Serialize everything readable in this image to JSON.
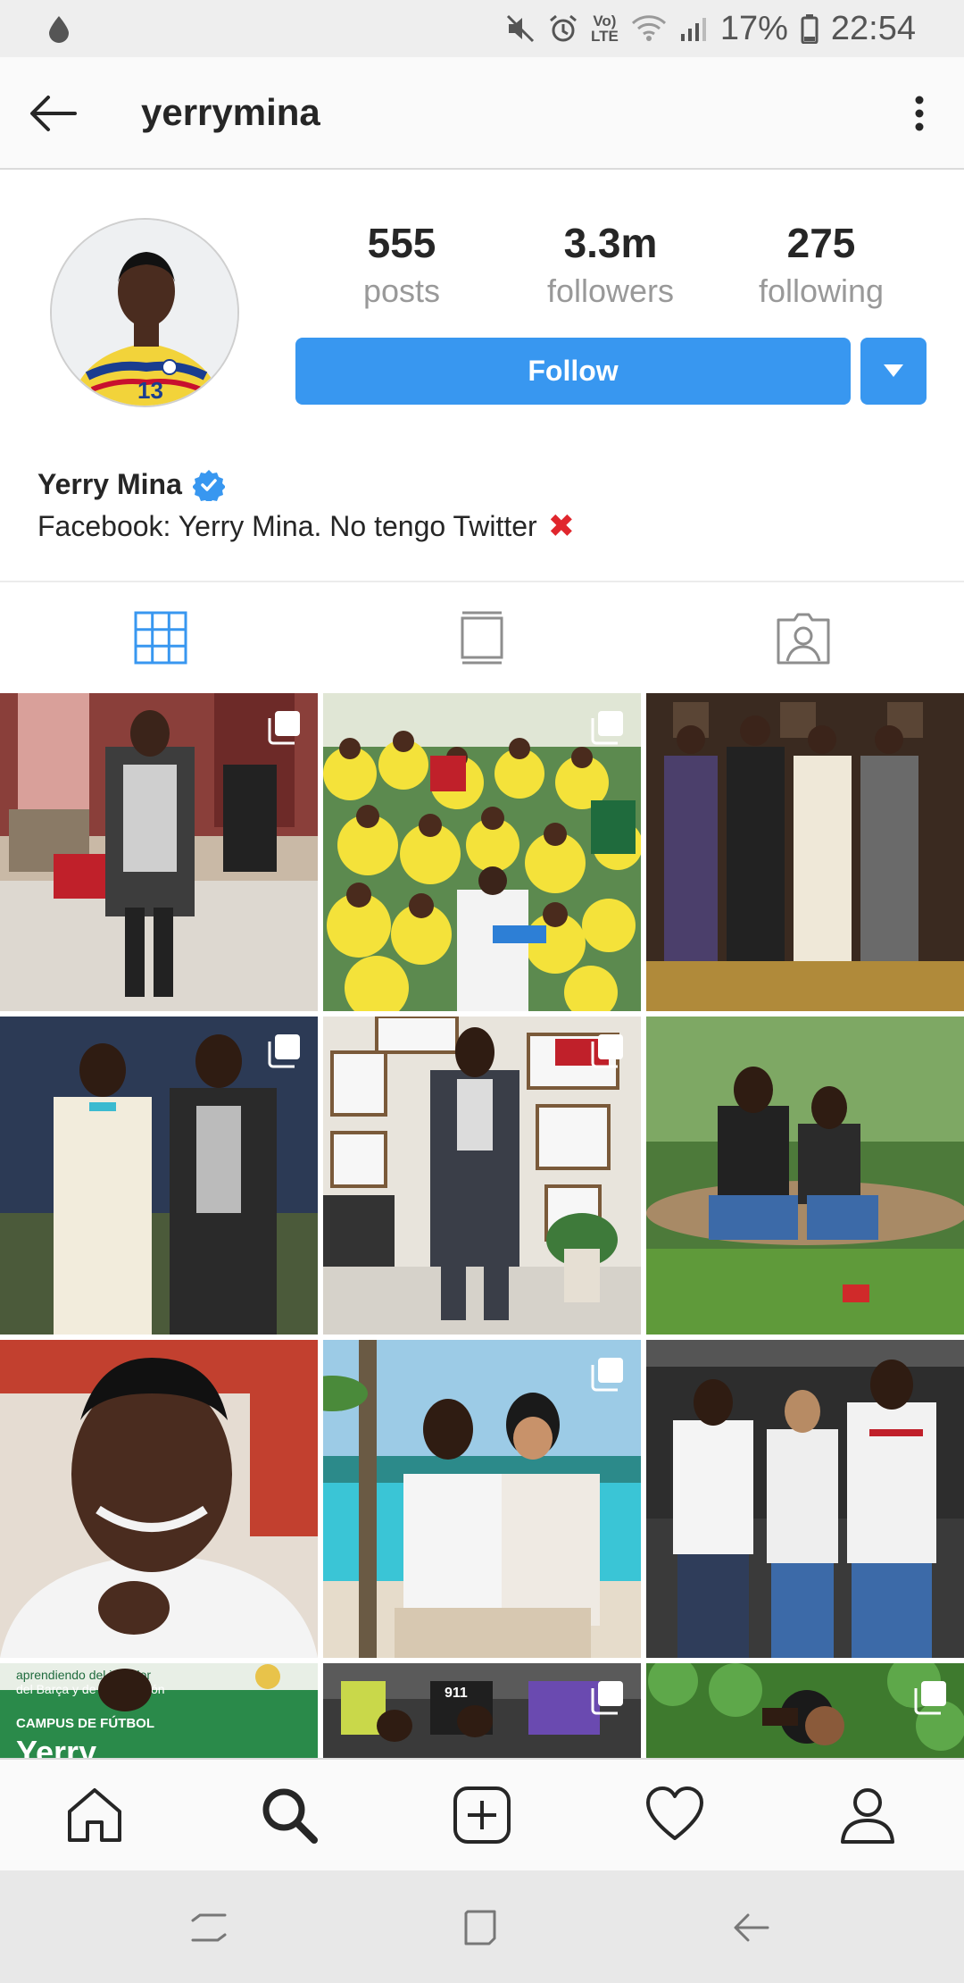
{
  "status_bar": {
    "battery": "17%",
    "time": "22:54",
    "network_label_top": "Vo)",
    "network_label_bottom": "LTE"
  },
  "app_bar": {
    "username": "yerrymina"
  },
  "profile": {
    "stats": [
      {
        "value": "555",
        "label": "posts"
      },
      {
        "value": "3.3m",
        "label": "followers"
      },
      {
        "value": "275",
        "label": "following"
      }
    ],
    "follow_label": "Follow",
    "full_name": "Yerry Mina",
    "bio": "Facebook: Yerry Mina. No tengo Twitter",
    "bio_emoji": "✖"
  },
  "tiles": {
    "t10_line1": "aprendiendo del jugador",
    "t10_line2": "del Barça y de la selección",
    "t10_line3": "CAMPUS DE FÚTBOL",
    "t10_line4": "Yerry",
    "t11_jersey": "911"
  },
  "colors": {
    "accent": "#3897f0",
    "verified": "#3897f0",
    "text": "#262626",
    "muted": "#999999"
  },
  "icons": [
    "back-arrow-icon",
    "more-vert-icon",
    "verified-badge-icon",
    "grid-icon",
    "feed-icon",
    "tagged-icon",
    "home-icon",
    "search-icon",
    "add-post-icon",
    "heart-icon",
    "profile-icon",
    "multi-photo-icon"
  ]
}
